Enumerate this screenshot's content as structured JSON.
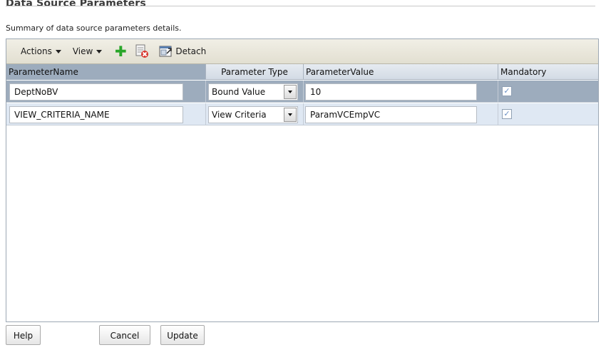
{
  "page": {
    "title": "Data Source Parameters",
    "subtitle": "Summary of data source parameters details."
  },
  "toolbar": {
    "actions_label": "Actions",
    "view_label": "View",
    "detach_label": "Detach",
    "add_icon": "plus-icon",
    "delete_icon": "delete-icon",
    "detach_icon": "detach-icon"
  },
  "table": {
    "columns": [
      "ParameterName",
      "Parameter Type",
      "ParameterValue",
      "Mandatory"
    ],
    "rows": [
      {
        "name": "DeptNoBV",
        "type": "Bound Value",
        "value": "10",
        "mandatory": true
      },
      {
        "name": "VIEW_CRITERIA_NAME",
        "type": "View Criteria",
        "value": "ParamVCEmpVC",
        "mandatory": true
      }
    ]
  },
  "buttons": {
    "help": "Help",
    "cancel": "Cancel",
    "update": "Update"
  },
  "colors": {
    "selected_row": "#9dacbd",
    "alt_row": "#dfe8f3",
    "toolbar_bg": "#e8e6da",
    "add_green": "#2aa62a",
    "delete_red": "#d8332a"
  }
}
